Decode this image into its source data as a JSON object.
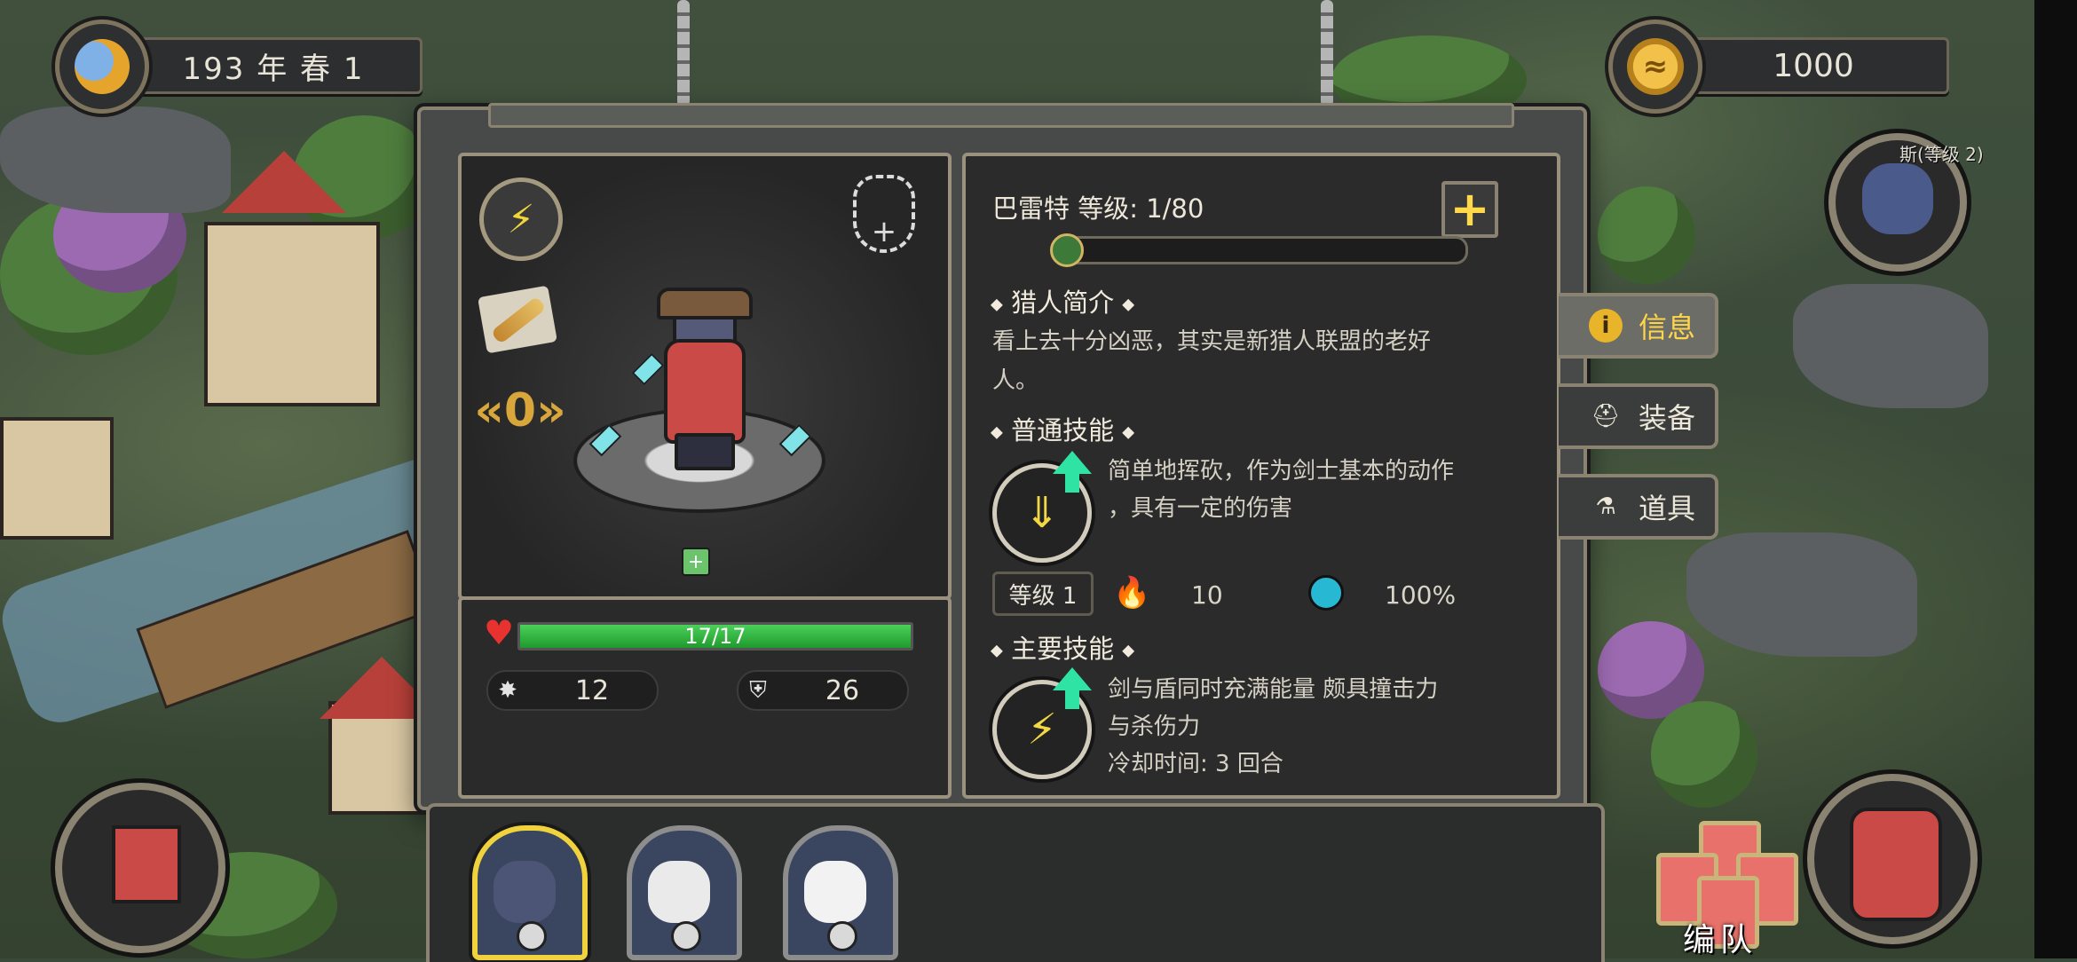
{
  "top": {
    "date_text": "193 年 春 1",
    "coins": "1000"
  },
  "hero": {
    "name_level": "巴雷特  等级: 1/80",
    "hp": "17/17",
    "hp_fraction": 1.0,
    "xp_fraction": 0.0,
    "attack": "12",
    "defense": "26"
  },
  "intro": {
    "title": "猎人简介",
    "text_line1": "看上去十分凶恶，其实是新猎人联盟的老好",
    "text_line2": "人。"
  },
  "normal_skill": {
    "title": "普通技能",
    "desc_line1": "简单地挥砍，作为剑士基本的动作",
    "desc_line2": "，具有一定的伤害",
    "level_label": "等级 1",
    "damage": "10",
    "hit_rate": "100%"
  },
  "main_skill": {
    "title": "主要技能",
    "desc_line1": "剑与盾同时充满能量 颇具撞击力",
    "desc_line2": "与杀伤力",
    "cooldown": "冷却时间: 3 回合"
  },
  "tabs": [
    {
      "label": "信息",
      "active": true,
      "icon": "info-icon"
    },
    {
      "label": "装备",
      "active": false,
      "icon": "helmet-icon"
    },
    {
      "label": "道具",
      "active": false,
      "icon": "potion-icon"
    }
  ],
  "rank_number": "0",
  "top_right_label": "斯(等级 2)",
  "team_button_label": "编队",
  "colors": {
    "accent_gold": "#ffd54a",
    "hp_green": "#1f9a2d",
    "frame": "#8a8372"
  }
}
